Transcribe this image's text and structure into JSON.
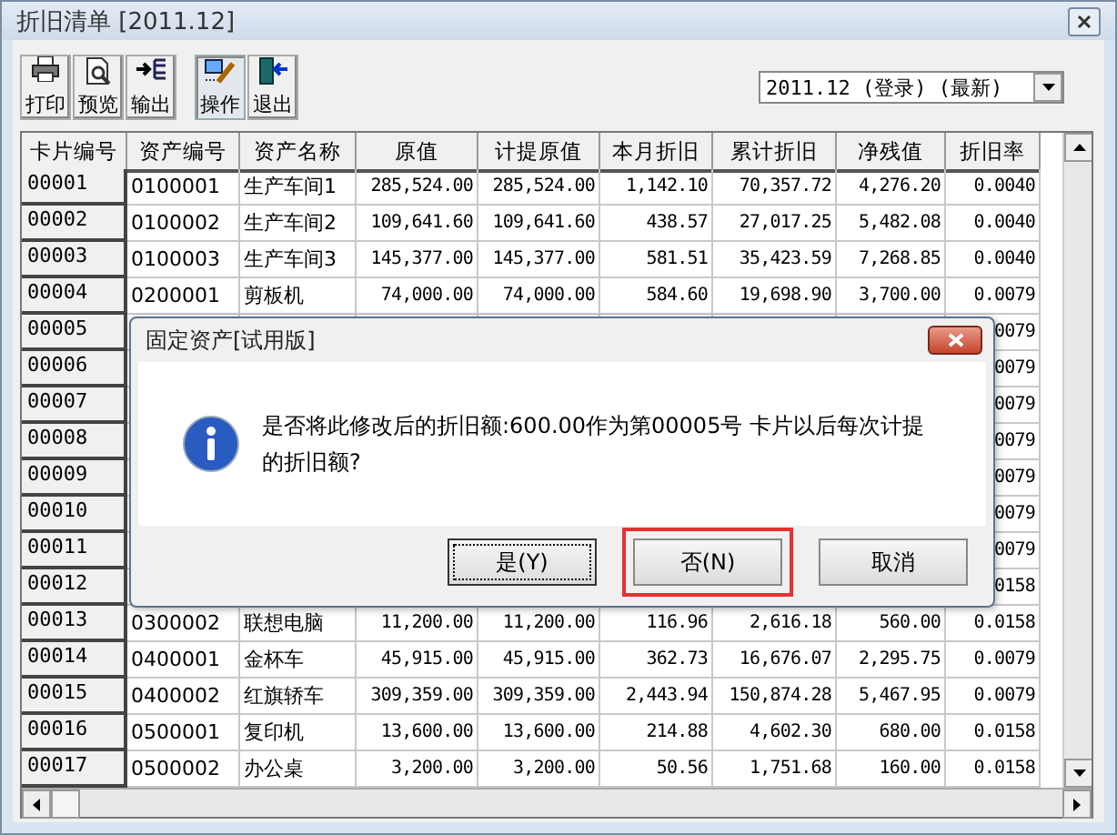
{
  "window": {
    "title": "折旧清单 [2011.12]"
  },
  "toolbar": [
    {
      "label": "打印",
      "kind": "print",
      "selected": false
    },
    {
      "label": "预览",
      "kind": "preview",
      "selected": false
    },
    {
      "label": "输出",
      "kind": "export",
      "selected": false
    },
    {
      "label": "操作",
      "kind": "operate",
      "selected": true
    },
    {
      "label": "退出",
      "kind": "exit",
      "selected": false
    }
  ],
  "period_select": {
    "value": "2011.12 (登录) (最新)"
  },
  "table": {
    "columns": [
      "卡片编号",
      "资产编号",
      "资产名称",
      "原值",
      "计提原值",
      "本月折旧",
      "累计折旧",
      "净残值",
      "折旧率"
    ],
    "rows": [
      [
        "00001",
        "0100001",
        "生产车间1",
        "285,524.00",
        "285,524.00",
        "1,142.10",
        "70,357.72",
        "4,276.20",
        "0.0040"
      ],
      [
        "00002",
        "0100002",
        "生产车间2",
        "109,641.60",
        "109,641.60",
        "438.57",
        "27,017.25",
        "5,482.08",
        "0.0040"
      ],
      [
        "00003",
        "0100003",
        "生产车间3",
        "145,377.00",
        "145,377.00",
        "581.51",
        "35,423.59",
        "7,268.85",
        "0.0040"
      ],
      [
        "00004",
        "0200001",
        "剪板机",
        "74,000.00",
        "74,000.00",
        "584.60",
        "19,698.90",
        "3,700.00",
        "0.0079"
      ],
      [
        "00005",
        "",
        "",
        "",
        "",
        "",
        "",
        "",
        "0079"
      ],
      [
        "00006",
        "",
        "",
        "",
        "",
        "",
        "",
        "",
        "0079"
      ],
      [
        "00007",
        "",
        "",
        "",
        "",
        "",
        "",
        "",
        "0079"
      ],
      [
        "00008",
        "",
        "",
        "",
        "",
        "",
        "",
        "",
        "0079"
      ],
      [
        "00009",
        "",
        "",
        "",
        "",
        "",
        "",
        "",
        "0079"
      ],
      [
        "00010",
        "",
        "",
        "",
        "",
        "",
        "",
        "",
        "0079"
      ],
      [
        "00011",
        "",
        "",
        "",
        "",
        "",
        "",
        "",
        "0079"
      ],
      [
        "00012",
        "",
        "",
        "",
        "",
        "",
        "",
        "",
        "0158"
      ],
      [
        "00013",
        "0300002",
        "联想电脑",
        "11,200.00",
        "11,200.00",
        "116.96",
        "2,616.18",
        "560.00",
        "0.0158"
      ],
      [
        "00014",
        "0400001",
        "金杯车",
        "45,915.00",
        "45,915.00",
        "362.73",
        "16,676.07",
        "2,295.75",
        "0.0079"
      ],
      [
        "00015",
        "0400002",
        "红旗轿车",
        "309,359.00",
        "309,359.00",
        "2,443.94",
        "150,874.28",
        "5,467.95",
        "0.0079"
      ],
      [
        "00016",
        "0500001",
        "复印机",
        "13,600.00",
        "13,600.00",
        "214.88",
        "4,602.30",
        "680.00",
        "0.0158"
      ],
      [
        "00017",
        "0500002",
        "办公桌",
        "3,200.00",
        "3,200.00",
        "50.56",
        "1,751.68",
        "160.00",
        "0.0158"
      ]
    ]
  },
  "dialog": {
    "title": "固定资产[试用版]",
    "message": "是否将此修改后的折旧额:600.00作为第00005号 卡片以后每次计提的折旧额?",
    "buttons": [
      {
        "label": "是(Y)",
        "selected": true,
        "highlighted": false
      },
      {
        "label": "否(N)",
        "selected": false,
        "highlighted": true
      },
      {
        "label": "取消",
        "selected": false,
        "highlighted": false
      }
    ]
  }
}
